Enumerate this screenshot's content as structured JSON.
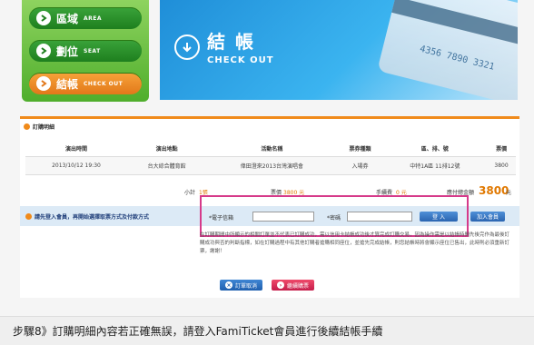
{
  "steps": [
    {
      "zh": "區域",
      "en": "AREA"
    },
    {
      "zh": "劃位",
      "en": "SEAT"
    },
    {
      "zh": "結帳",
      "en": "CHECK OUT"
    }
  ],
  "hero": {
    "zh": "結 帳",
    "en": "CHECK OUT",
    "card_number": "4356 7890 3321"
  },
  "panel": {
    "title": "訂購明細"
  },
  "table": {
    "headers": [
      "演出時間",
      "演出地點",
      "活動名稱",
      "票券種類",
      "區、排、號",
      "票價"
    ],
    "rows": [
      [
        "2013/10/12 19:30",
        "台大綜合體育館",
        "偉田澄來2013台灣演唱會",
        "入場券",
        "中特1A區 11排12號",
        "3800"
      ]
    ]
  },
  "totals": {
    "subtotal_label": "小計",
    "subtotal_value": "1張",
    "ticket_price_label": "票價",
    "ticket_price_value": "3800 元",
    "fee_label": "手續費",
    "fee_value": "0 元",
    "grand_total_label": "應付總金額",
    "grand_total_value": "3800",
    "currency": "元"
  },
  "login": {
    "prompt": "請先登入會員，再開始選擇取票方式及付款方式",
    "email_label": "*電子信箱",
    "password_label": "*密碼",
    "login_button": "登 入",
    "join_button": "加入會員"
  },
  "notice": "在訂購期間中所顯示的相關訂單並不代表已訂購成功，需以信用卡結帳成功後才算完成訂購交易，因為操作需是以結帳時間先後完作為最後訂購成功與否的判斷指標，如在訂購過程中有其他訂購者搶購相同座位，並搶先完成結帳，則您結帳時將會顯示座位已售出，此時則必須重新訂票，謝謝！",
  "actions": {
    "cancel": "訂單取消",
    "next": "繼續購票"
  },
  "caption": "步驟8》訂購明細內容若正確無誤，請登入FamiTicket會員進行後續結帳手續"
}
